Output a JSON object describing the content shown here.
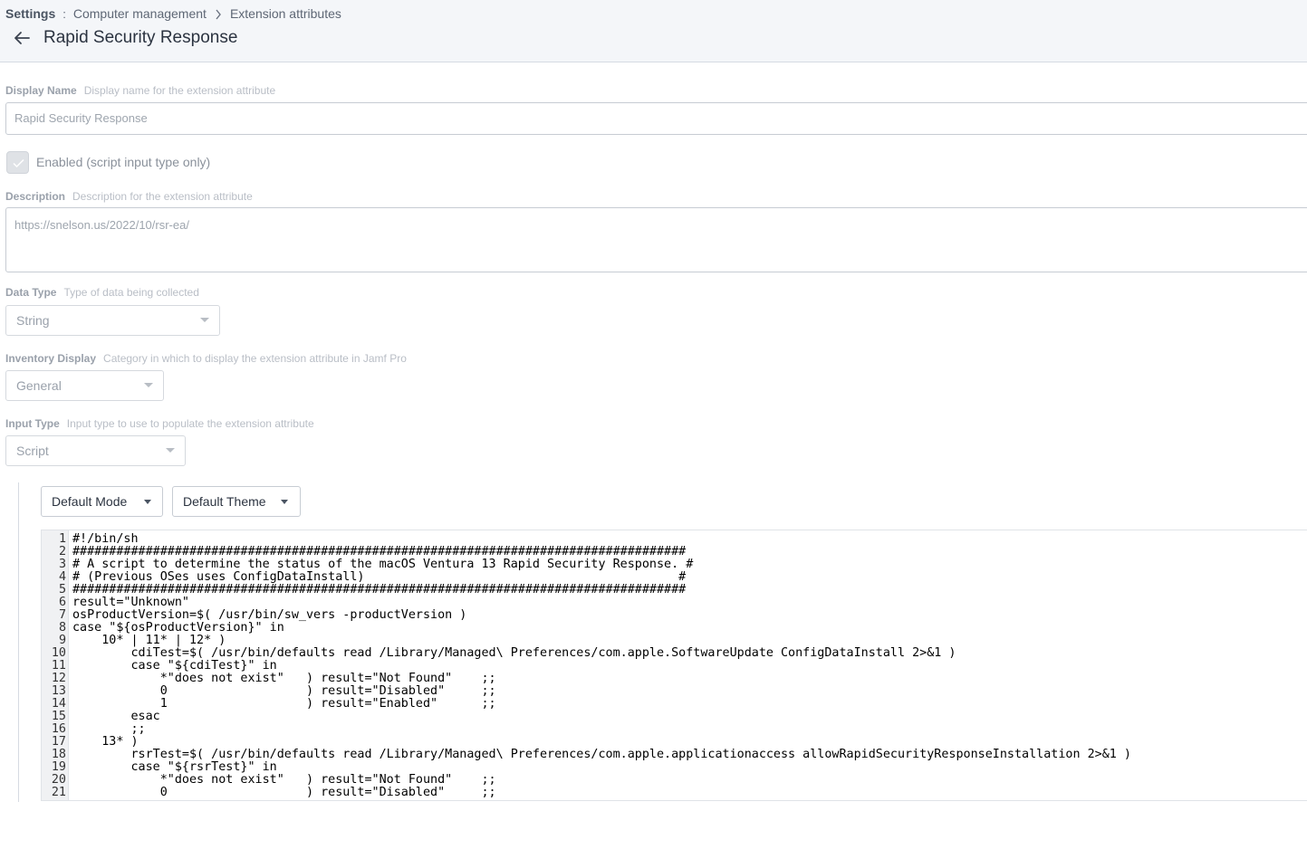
{
  "breadcrumb": {
    "root": "Settings",
    "separator": ":",
    "section": "Computer management",
    "current": "Extension attributes"
  },
  "page": {
    "title": "Rapid Security Response"
  },
  "display_name": {
    "label": "Display Name",
    "hint": "Display name for the extension attribute",
    "value": "Rapid Security Response"
  },
  "enabled": {
    "label": "Enabled (script input type only)",
    "checked": true
  },
  "description": {
    "label": "Description",
    "hint": "Description for the extension attribute",
    "value": "https://snelson.us/2022/10/rsr-ea/"
  },
  "data_type": {
    "label": "Data Type",
    "hint": "Type of data being collected",
    "value": "String"
  },
  "inventory_display": {
    "label": "Inventory Display",
    "hint": "Category in which to display the extension attribute in Jamf Pro",
    "value": "General"
  },
  "input_type": {
    "label": "Input Type",
    "hint": "Input type to use to populate the extension attribute",
    "value": "Script"
  },
  "editor": {
    "mode_label": "Default Mode",
    "theme_label": "Default Theme",
    "lines": [
      {
        "n": "1",
        "text": "#!/bin/sh"
      },
      {
        "n": "2",
        "text": "####################################################################################"
      },
      {
        "n": "3",
        "text": "# A script to determine the status of the macOS Ventura 13 Rapid Security Response. #"
      },
      {
        "n": "4",
        "text": "# (Previous OSes uses ConfigDataInstall)                                           #"
      },
      {
        "n": "5",
        "text": "####################################################################################"
      },
      {
        "n": "6",
        "text": "result=\"Unknown\""
      },
      {
        "n": "7",
        "text": "osProductVersion=$( /usr/bin/sw_vers -productVersion )"
      },
      {
        "n": "8",
        "text": "case \"${osProductVersion}\" in"
      },
      {
        "n": "9",
        "text": "    10* | 11* | 12* )"
      },
      {
        "n": "10",
        "text": "        cdiTest=$( /usr/bin/defaults read /Library/Managed\\ Preferences/com.apple.SoftwareUpdate ConfigDataInstall 2>&1 )"
      },
      {
        "n": "11",
        "text": "        case \"${cdiTest}\" in"
      },
      {
        "n": "12",
        "text": "            *\"does not exist\"   ) result=\"Not Found\"    ;;"
      },
      {
        "n": "13",
        "text": "            0                   ) result=\"Disabled\"     ;;"
      },
      {
        "n": "14",
        "text": "            1                   ) result=\"Enabled\"      ;;"
      },
      {
        "n": "15",
        "text": "        esac"
      },
      {
        "n": "16",
        "text": "        ;;"
      },
      {
        "n": "17",
        "text": "    13* )"
      },
      {
        "n": "18",
        "text": "        rsrTest=$( /usr/bin/defaults read /Library/Managed\\ Preferences/com.apple.applicationaccess allowRapidSecurityResponseInstallation 2>&1 )"
      },
      {
        "n": "19",
        "text": "        case \"${rsrTest}\" in"
      },
      {
        "n": "20",
        "text": "            *\"does not exist\"   ) result=\"Not Found\"    ;;"
      },
      {
        "n": "21",
        "text": "            0                   ) result=\"Disabled\"     ;;"
      }
    ]
  }
}
